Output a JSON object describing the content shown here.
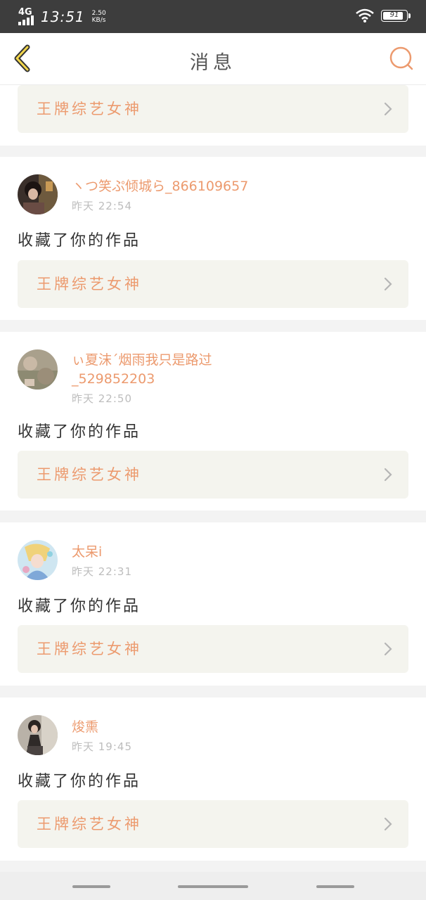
{
  "status_bar": {
    "network": "4G",
    "time": "13:51",
    "rate_value": "2.50",
    "rate_unit": "KB/s",
    "battery": "91",
    "battery_level": 0.91
  },
  "nav": {
    "title": "消息"
  },
  "partial_item": {
    "work_title": "王牌综艺女神"
  },
  "messages": [
    {
      "user": "ヽつ笑ぷ倾城ら_866109657",
      "time": "昨天 22:54",
      "action": "收藏了你的作品",
      "work_title": "王牌综艺女神"
    },
    {
      "user_line1": "ぃ夏沫ˊ烟雨我只是路过",
      "user_line2": "_529852203",
      "time": "昨天 22:50",
      "action": "收藏了你的作品",
      "work_title": "王牌综艺女神"
    },
    {
      "user": "太呆i",
      "time": "昨天 22:31",
      "action": "收藏了你的作品",
      "work_title": "王牌综艺女神"
    },
    {
      "user": "焌熏",
      "time": "昨天 19:45",
      "action": "收藏了你的作品",
      "work_title": "王牌综艺女神"
    }
  ],
  "colors": {
    "accent": "#ec9a6e",
    "status_bar_bg": "#3d3d3d",
    "card_inner_bg": "#f4f4ee"
  }
}
